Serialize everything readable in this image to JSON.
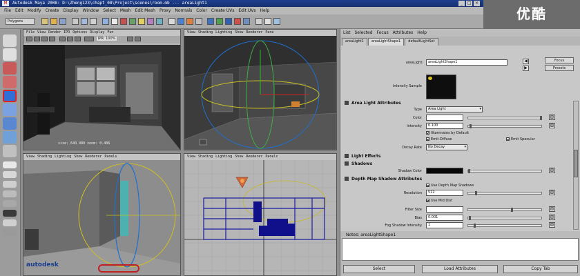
{
  "window": {
    "title": "Autodesk Maya 2008: D:\\Zheng123\\chapt_08\\Project\\scenes\\room.mb   ---   areaLight1",
    "app_badge": "M",
    "controls": [
      "_",
      "□",
      "×"
    ]
  },
  "logo_text": "优酷",
  "main_menu": [
    "File",
    "Edit",
    "Modify",
    "Create",
    "Display",
    "Window",
    "Select",
    "Mesh",
    "Edit Mesh",
    "Proxy",
    "Normals",
    "Color",
    "Create UVs",
    "Edit UVs",
    "Help"
  ],
  "status_line": {
    "mode": "Polygons"
  },
  "viewports": {
    "top_left": {
      "menu": [
        "File",
        "View",
        "Render",
        "IPR",
        "Options",
        "Display",
        "Fun"
      ],
      "readout": "size: 640 480 zoom: 0.406",
      "ipr_label": "IPR: 100%"
    },
    "top_right": {
      "menu": [
        "View",
        "Shading",
        "Lighting",
        "Show",
        "Renderer",
        "Pane"
      ]
    },
    "bottom_left": {
      "menu": [
        "View",
        "Shading",
        "Lighting",
        "Show",
        "Renderer",
        "Panels"
      ]
    },
    "bottom_right": {
      "menu": [
        "View",
        "Shading",
        "Lighting",
        "Show",
        "Renderer",
        "Panels"
      ]
    }
  },
  "attribute_editor": {
    "menu": [
      "List",
      "Selected",
      "Focus",
      "Attributes",
      "Help"
    ],
    "tabs": [
      "areaLight1",
      "areaLightShape1",
      "defaultLightSet"
    ],
    "node_label": "areaLight:",
    "node_value": "areaLightShape1",
    "focus_label": "Focus",
    "presets_label": "Presets",
    "intensity_sample_label": "Intensity Sample",
    "section_area_light": "Area Light Attributes",
    "type_label": "Type",
    "type_value": "Area Light",
    "color_label": "Color",
    "intensity_label": "Intensity",
    "intensity_value": "0.100",
    "illuminates_default": "Illuminates by Default",
    "emit_diffuse": "Emit Diffuse",
    "emit_specular": "Emit Specular",
    "decay_label": "Decay Rate",
    "decay_value": "No Decay",
    "section_light_effects": "Light Effects",
    "section_shadows": "Shadows",
    "shadow_color_label": "Shadow Color",
    "section_depth_map": "Depth Map Shadow Attributes",
    "use_depth_map": "Use Depth Map Shadows",
    "resolution_label": "Resolution",
    "resolution_value": "512",
    "use_mid_dist": "Use Mid Dist",
    "filter_size_label": "Filter Size",
    "filter_size_value": "",
    "bias_label": "Bias",
    "bias_value": "0.001",
    "fog_label": "Fog Shadow Intensity",
    "fog_value": "1",
    "notes_label": "Notes:  areaLightShape1",
    "buttons": {
      "select": "Select",
      "load": "Load Attributes",
      "copy": "Copy Tab"
    }
  },
  "watermark": "autodesk",
  "colors": {
    "title_bar": "#1e3f8e",
    "logo_bg": "#6c6c6c",
    "panel_bg": "#c8c8c8",
    "viewport_bg": "#3a3a3a"
  }
}
